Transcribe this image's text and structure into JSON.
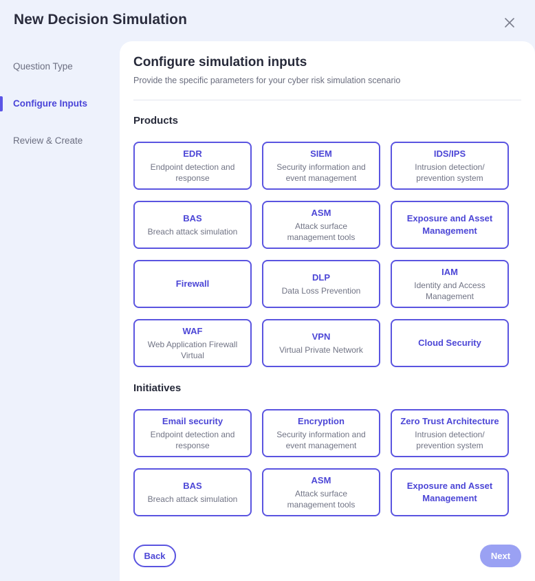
{
  "header": {
    "title": "New Decision Simulation"
  },
  "sidebar": {
    "items": [
      {
        "label": "Question Type"
      },
      {
        "label": "Configure Inputs"
      },
      {
        "label": "Review & Create"
      }
    ]
  },
  "panel": {
    "title": "Configure simulation inputs",
    "subtitle": "Provide the specific parameters for your cyber risk simulation scenario"
  },
  "products": {
    "title": "Products",
    "items": [
      {
        "title": "EDR",
        "desc": "Endpoint detection and response"
      },
      {
        "title": "SIEM",
        "desc": "Security information and event management"
      },
      {
        "title": "IDS/IPS",
        "desc": "Intrusion detection/ prevention system"
      },
      {
        "title": "BAS",
        "desc": "Breach attack simulation"
      },
      {
        "title": "ASM",
        "desc": "Attack surface management tools"
      },
      {
        "title": "Exposure and Asset Management",
        "desc": ""
      },
      {
        "title": "Firewall",
        "desc": ""
      },
      {
        "title": "DLP",
        "desc": "Data Loss Prevention"
      },
      {
        "title": "IAM",
        "desc": "Identity and Access Management"
      },
      {
        "title": "WAF",
        "desc": "Web Application Firewall Virtual"
      },
      {
        "title": "VPN",
        "desc": "Virtual Private Network"
      },
      {
        "title": "Cloud Security",
        "desc": ""
      }
    ]
  },
  "initiatives": {
    "title": "Initiatives",
    "items": [
      {
        "title": "Email security",
        "desc": "Endpoint detection and response"
      },
      {
        "title": "Encryption",
        "desc": "Security information and event management"
      },
      {
        "title": "Zero Trust Architecture",
        "desc": "Intrusion detection/ prevention system"
      },
      {
        "title": "BAS",
        "desc": "Breach attack simulation"
      },
      {
        "title": "ASM",
        "desc": "Attack surface management tools"
      },
      {
        "title": "Exposure and Asset Management",
        "desc": ""
      }
    ]
  },
  "footer": {
    "back_label": "Back",
    "next_label": "Next"
  },
  "colors": {
    "accent": "#5a54e0",
    "next_disabled": "#9aa1f3",
    "background": "#eef2fc"
  }
}
